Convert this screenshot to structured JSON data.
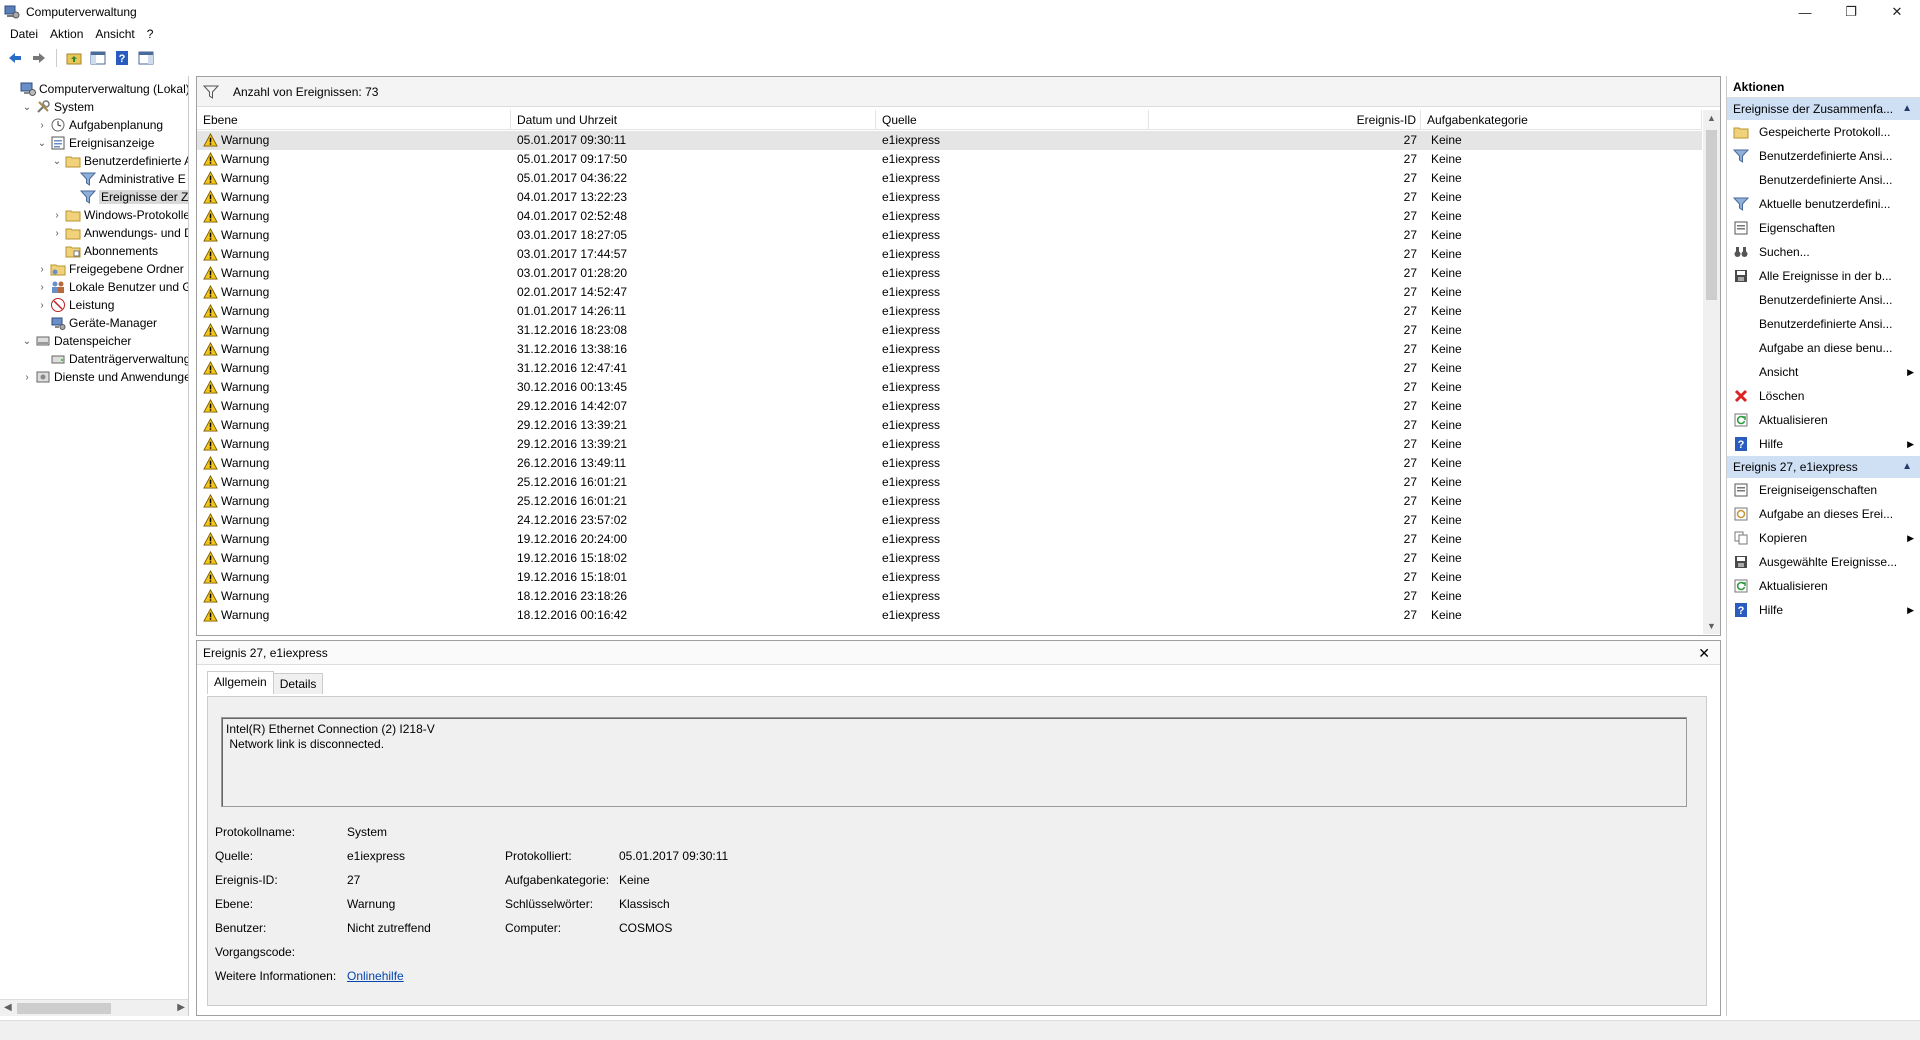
{
  "window": {
    "title": "Computerverwaltung",
    "minimize": "—",
    "restore": "❐",
    "close": "✕"
  },
  "menu": [
    "Datei",
    "Aktion",
    "Ansicht",
    "?"
  ],
  "tree": [
    {
      "label": "Computerverwaltung (Lokal)",
      "level": 0,
      "exp": "",
      "icon": "computer-icon"
    },
    {
      "label": "System",
      "level": 1,
      "exp": "▾",
      "icon": "tools-icon"
    },
    {
      "label": "Aufgabenplanung",
      "level": 2,
      "exp": "›",
      "icon": "clock-icon"
    },
    {
      "label": "Ereignisanzeige",
      "level": 2,
      "exp": "▾",
      "icon": "event-viewer-icon"
    },
    {
      "label": "Benutzerdefinierte A",
      "level": 3,
      "exp": "▾",
      "icon": "folder-icon"
    },
    {
      "label": "Administrative E",
      "level": 4,
      "exp": "",
      "icon": "filter-icon"
    },
    {
      "label": "Ereignisse der Zu",
      "level": 4,
      "exp": "",
      "icon": "filter-icon",
      "selected": true
    },
    {
      "label": "Windows-Protokolle",
      "level": 3,
      "exp": "›",
      "icon": "folder-icon"
    },
    {
      "label": "Anwendungs- und D",
      "level": 3,
      "exp": "›",
      "icon": "folder-icon"
    },
    {
      "label": "Abonnements",
      "level": 3,
      "exp": "",
      "icon": "subscription-icon"
    },
    {
      "label": "Freigegebene Ordner",
      "level": 2,
      "exp": "›",
      "icon": "shared-folder-icon"
    },
    {
      "label": "Lokale Benutzer und Gr",
      "level": 2,
      "exp": "›",
      "icon": "users-icon"
    },
    {
      "label": "Leistung",
      "level": 2,
      "exp": "›",
      "icon": "performance-icon"
    },
    {
      "label": "Geräte-Manager",
      "level": 2,
      "exp": "",
      "icon": "device-manager-icon"
    },
    {
      "label": "Datenspeicher",
      "level": 1,
      "exp": "▾",
      "icon": "storage-icon"
    },
    {
      "label": "Datenträgerverwaltung",
      "level": 2,
      "exp": "",
      "icon": "disk-icon"
    },
    {
      "label": "Dienste und Anwendungen",
      "level": 1,
      "exp": "›",
      "icon": "services-icon"
    }
  ],
  "grid": {
    "count_label": "Anzahl von Ereignissen: 73",
    "columns": [
      "Ebene",
      "Datum und Uhrzeit",
      "Quelle",
      "Ereignis-ID",
      "Aufgabenkategorie"
    ],
    "rows": [
      [
        "Warnung",
        "05.01.2017 09:30:11",
        "e1iexpress",
        "27",
        "Keine"
      ],
      [
        "Warnung",
        "05.01.2017 09:17:50",
        "e1iexpress",
        "27",
        "Keine"
      ],
      [
        "Warnung",
        "05.01.2017 04:36:22",
        "e1iexpress",
        "27",
        "Keine"
      ],
      [
        "Warnung",
        "04.01.2017 13:22:23",
        "e1iexpress",
        "27",
        "Keine"
      ],
      [
        "Warnung",
        "04.01.2017 02:52:48",
        "e1iexpress",
        "27",
        "Keine"
      ],
      [
        "Warnung",
        "03.01.2017 18:27:05",
        "e1iexpress",
        "27",
        "Keine"
      ],
      [
        "Warnung",
        "03.01.2017 17:44:57",
        "e1iexpress",
        "27",
        "Keine"
      ],
      [
        "Warnung",
        "03.01.2017 01:28:20",
        "e1iexpress",
        "27",
        "Keine"
      ],
      [
        "Warnung",
        "02.01.2017 14:52:47",
        "e1iexpress",
        "27",
        "Keine"
      ],
      [
        "Warnung",
        "01.01.2017 14:26:11",
        "e1iexpress",
        "27",
        "Keine"
      ],
      [
        "Warnung",
        "31.12.2016 18:23:08",
        "e1iexpress",
        "27",
        "Keine"
      ],
      [
        "Warnung",
        "31.12.2016 13:38:16",
        "e1iexpress",
        "27",
        "Keine"
      ],
      [
        "Warnung",
        "31.12.2016 12:47:41",
        "e1iexpress",
        "27",
        "Keine"
      ],
      [
        "Warnung",
        "30.12.2016 00:13:45",
        "e1iexpress",
        "27",
        "Keine"
      ],
      [
        "Warnung",
        "29.12.2016 14:42:07",
        "e1iexpress",
        "27",
        "Keine"
      ],
      [
        "Warnung",
        "29.12.2016 13:39:21",
        "e1iexpress",
        "27",
        "Keine"
      ],
      [
        "Warnung",
        "29.12.2016 13:39:21",
        "e1iexpress",
        "27",
        "Keine"
      ],
      [
        "Warnung",
        "26.12.2016 13:49:11",
        "e1iexpress",
        "27",
        "Keine"
      ],
      [
        "Warnung",
        "25.12.2016 16:01:21",
        "e1iexpress",
        "27",
        "Keine"
      ],
      [
        "Warnung",
        "25.12.2016 16:01:21",
        "e1iexpress",
        "27",
        "Keine"
      ],
      [
        "Warnung",
        "24.12.2016 23:57:02",
        "e1iexpress",
        "27",
        "Keine"
      ],
      [
        "Warnung",
        "19.12.2016 20:24:00",
        "e1iexpress",
        "27",
        "Keine"
      ],
      [
        "Warnung",
        "19.12.2016 15:18:02",
        "e1iexpress",
        "27",
        "Keine"
      ],
      [
        "Warnung",
        "19.12.2016 15:18:01",
        "e1iexpress",
        "27",
        "Keine"
      ],
      [
        "Warnung",
        "18.12.2016 23:18:26",
        "e1iexpress",
        "27",
        "Keine"
      ],
      [
        "Warnung",
        "18.12.2016 00:16:42",
        "e1iexpress",
        "27",
        "Keine"
      ]
    ]
  },
  "detail": {
    "title": "Ereignis 27, e1iexpress",
    "tabs": [
      "Allgemein",
      "Details"
    ],
    "message_line1": "Intel(R) Ethernet Connection (2) I218-V",
    "message_line2": " Network link is disconnected.",
    "labels": {
      "protokollname": "Protokollname:",
      "quelle": "Quelle:",
      "ereignis_id": "Ereignis-ID:",
      "ebene": "Ebene:",
      "benutzer": "Benutzer:",
      "vorgangscode": "Vorgangscode:",
      "weitere": "Weitere Informationen:",
      "protokolliert": "Protokolliert:",
      "aufgabenkategorie": "Aufgabenkategorie:",
      "schluesselwoerter": "Schlüsselwörter:",
      "computer": "Computer:"
    },
    "values": {
      "protokollname": "System",
      "quelle": "e1iexpress",
      "ereignis_id": "27",
      "ebene": "Warnung",
      "benutzer": "Nicht zutreffend",
      "vorgangscode": "",
      "weitere": "Onlinehilfe",
      "protokolliert": "05.01.2017 09:30:11",
      "aufgabenkategorie": "Keine",
      "schluesselwoerter": "Klassisch",
      "computer": "COSMOS"
    }
  },
  "actions": {
    "title": "Aktionen",
    "section1": "Ereignisse der Zusammenfa...",
    "items1": [
      {
        "label": "Gespeicherte Protokoll...",
        "icon": "open-log-icon"
      },
      {
        "label": "Benutzerdefinierte Ansi...",
        "icon": "filter-icon"
      },
      {
        "label": "Benutzerdefinierte Ansi...",
        "icon": ""
      },
      {
        "label": "Aktuelle benutzerdefini...",
        "icon": "filter-icon"
      },
      {
        "label": "Eigenschaften",
        "icon": "properties-icon"
      },
      {
        "label": "Suchen...",
        "icon": "binoculars-icon"
      },
      {
        "label": "Alle Ereignisse in der b...",
        "icon": "save-icon"
      },
      {
        "label": "Benutzerdefinierte Ansi...",
        "icon": ""
      },
      {
        "label": "Benutzerdefinierte Ansi...",
        "icon": ""
      },
      {
        "label": "Aufgabe an diese benu...",
        "icon": ""
      },
      {
        "label": "Ansicht",
        "icon": "",
        "sub": true
      },
      {
        "label": "Löschen",
        "icon": "delete-icon"
      },
      {
        "label": "Aktualisieren",
        "icon": "refresh-icon"
      },
      {
        "label": "Hilfe",
        "icon": "help-icon",
        "sub": true
      }
    ],
    "section2": "Ereignis 27, e1iexpress",
    "items2": [
      {
        "label": "Ereigniseigenschaften",
        "icon": "properties-icon"
      },
      {
        "label": "Aufgabe an dieses Erei...",
        "icon": "task-icon"
      },
      {
        "label": "Kopieren",
        "icon": "copy-icon",
        "sub": true
      },
      {
        "label": "Ausgewählte Ereignisse...",
        "icon": "save-icon"
      },
      {
        "label": "Aktualisieren",
        "icon": "refresh-icon"
      },
      {
        "label": "Hilfe",
        "icon": "help-icon",
        "sub": true
      }
    ]
  }
}
